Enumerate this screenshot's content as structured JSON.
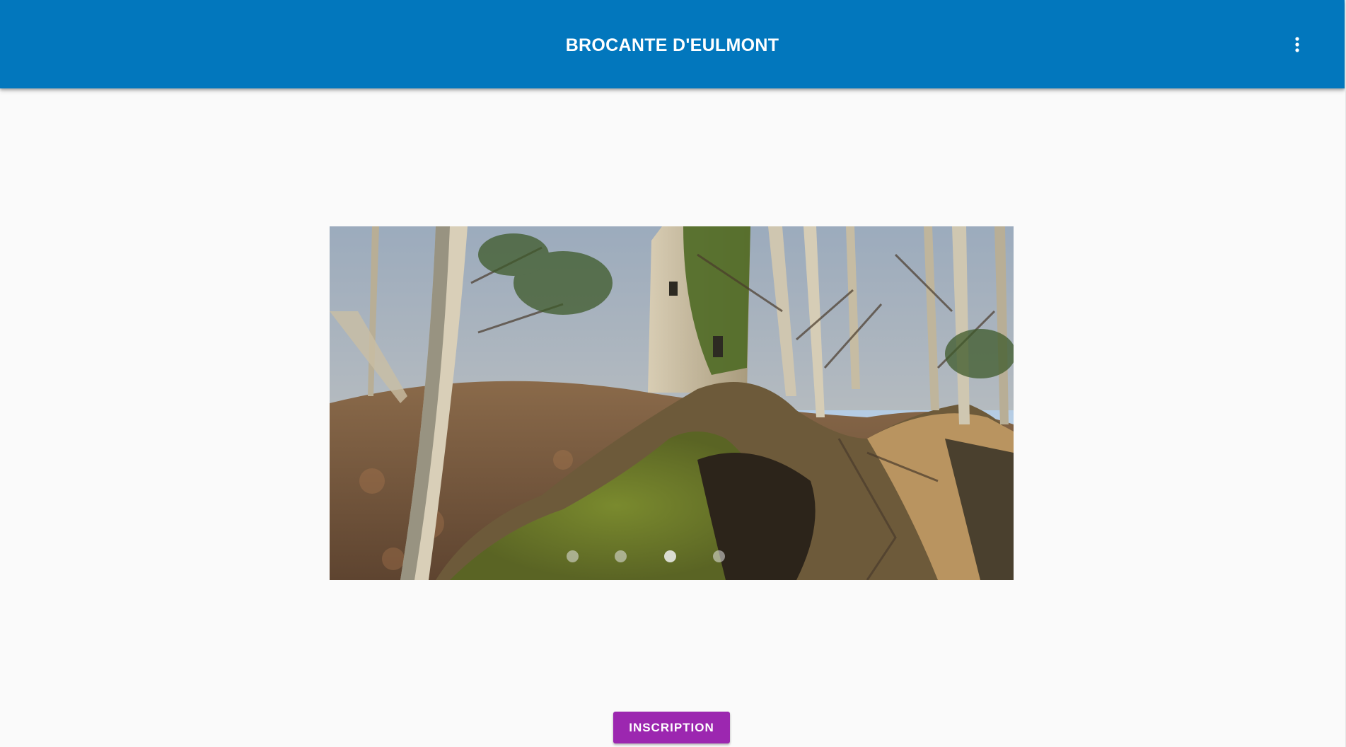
{
  "app_bar": {
    "title": "BROCANTE D'EULMONT",
    "menu_icon": "more-vert-icon",
    "background_color": "#0277bd"
  },
  "carousel": {
    "slide_count": 4,
    "active_slide": 3,
    "image_description_icon": "forest-ruin-photo"
  },
  "actions": {
    "register_label": "INSCRIPTION",
    "register_color": "#9c27b0"
  }
}
